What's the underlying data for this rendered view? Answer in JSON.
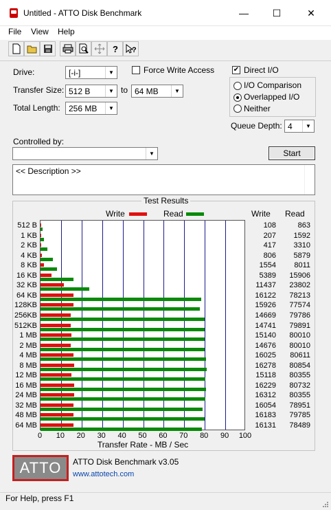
{
  "window": {
    "title": "Untitled - ATTO Disk Benchmark",
    "minimize_glyph": "—",
    "maximize_glyph": "☐",
    "close_glyph": "✕"
  },
  "menu": [
    "File",
    "View",
    "Help"
  ],
  "toolbar_icons": [
    "new-file-icon",
    "open-folder-icon",
    "save-icon",
    "print-icon",
    "print-preview-icon",
    "move-icon",
    "help-icon",
    "context-help-icon"
  ],
  "form": {
    "drive_label": "Drive:",
    "drive_value": "[-i-]",
    "force_write_label": "Force Write Access",
    "force_write_checked": false,
    "direct_io_label": "Direct I/O",
    "direct_io_checked": true,
    "transfer_size_label": "Transfer Size:",
    "transfer_from": "512 B",
    "to_label": "to",
    "transfer_to": "64 MB",
    "total_length_label": "Total Length:",
    "total_length": "256 MB",
    "io_comparison_label": "I/O Comparison",
    "overlapped_io_label": "Overlapped I/O",
    "neither_label": "Neither",
    "selected_mode": "Overlapped I/O",
    "queue_depth_label": "Queue Depth:",
    "queue_depth": "4",
    "controlled_by_label": "Controlled by:",
    "controlled_by_value": "",
    "start_label": "Start",
    "description": "<< Description >>"
  },
  "results": {
    "title": "Test Results",
    "legend_write": "Write",
    "legend_read": "Read",
    "col_write": "Write",
    "col_read": "Read",
    "xlabel": "Transfer Rate - MB / Sec"
  },
  "colors": {
    "write": "#e01010",
    "read": "#0a8a0a",
    "grid": "#1a1a8c",
    "logo_border": "#c51f1f"
  },
  "chart_data": {
    "type": "bar",
    "orientation": "horizontal",
    "categories": [
      "512 B",
      "1 KB",
      "2 KB",
      "4 KB",
      "8 KB",
      "16 KB",
      "32 KB",
      "64 KB",
      "128KB",
      "256KB",
      "512KB",
      "1 MB",
      "2 MB",
      "4 MB",
      "8 MB",
      "12 MB",
      "16 MB",
      "24 MB",
      "32 MB",
      "48 MB",
      "64 MB"
    ],
    "series": [
      {
        "name": "Write",
        "values": [
          108,
          207,
          417,
          806,
          1554,
          5389,
          11437,
          16122,
          15926,
          14669,
          14741,
          15140,
          14676,
          16025,
          16278,
          15118,
          16229,
          16312,
          16054,
          16183,
          16131
        ]
      },
      {
        "name": "Read",
        "values": [
          863,
          1592,
          3310,
          5879,
          8011,
          15906,
          23802,
          78213,
          77574,
          79786,
          79891,
          80010,
          80010,
          80611,
          80854,
          80355,
          80732,
          80355,
          78951,
          79785,
          78489
        ]
      }
    ],
    "xlabel": "Transfer Rate - MB / Sec",
    "x_ticks": [
      "0",
      "10",
      "20",
      "30",
      "40",
      "50",
      "60",
      "70",
      "80",
      "90",
      "100"
    ],
    "xlim": [
      0,
      100
    ],
    "unit_note": "bar length = value / 1000 (MB/s); values listed in KB/s"
  },
  "footer": {
    "logo_text": "ATTO",
    "product": "ATTO Disk Benchmark v3.05",
    "link": "www.attotech.com"
  },
  "status": "For Help, press F1"
}
